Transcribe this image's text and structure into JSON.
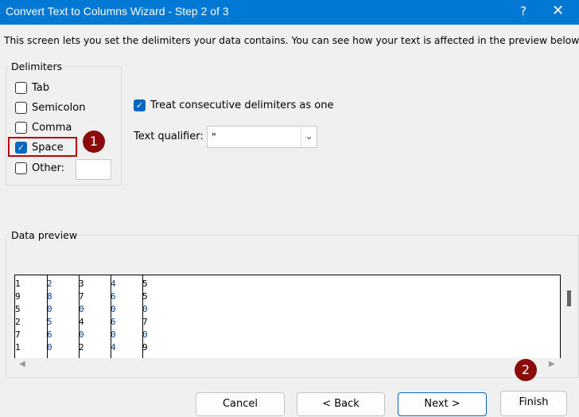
{
  "window": {
    "title": "Convert Text to Columns Wizard - Step 2 of 3",
    "help": "?",
    "close": "✕"
  },
  "description": "This screen lets you set the delimiters your data contains.  You can see how your text is affected in the preview below.",
  "delimiters": {
    "legend": "Delimiters",
    "items": [
      {
        "label": "Tab",
        "checked": false
      },
      {
        "label": "Semicolon",
        "checked": false
      },
      {
        "label": "Comma",
        "checked": false
      },
      {
        "label": "Space",
        "checked": true
      },
      {
        "label": "Other:",
        "checked": false
      }
    ],
    "other_value": ""
  },
  "consecutive": {
    "label": "Treat consecutive delimiters as one",
    "checked": true
  },
  "qualifier": {
    "label": "Text qualifier:",
    "value": "\""
  },
  "preview": {
    "legend": "Data preview",
    "rows": [
      [
        "1",
        "2",
        "3",
        "4",
        "5"
      ],
      [
        "9",
        "8",
        "7",
        "6",
        "5"
      ],
      [
        "5",
        "0",
        "0",
        "0",
        "0"
      ],
      [
        "2",
        "5",
        "4",
        "6",
        "7"
      ],
      [
        "7",
        "6",
        "0",
        "0",
        "0"
      ],
      [
        "1",
        "0",
        "2",
        "4",
        "9"
      ]
    ]
  },
  "badges": [
    "1",
    "2"
  ],
  "buttons": {
    "cancel": "Cancel",
    "back": "< Back",
    "next": "Next >",
    "finish": "Finish"
  }
}
